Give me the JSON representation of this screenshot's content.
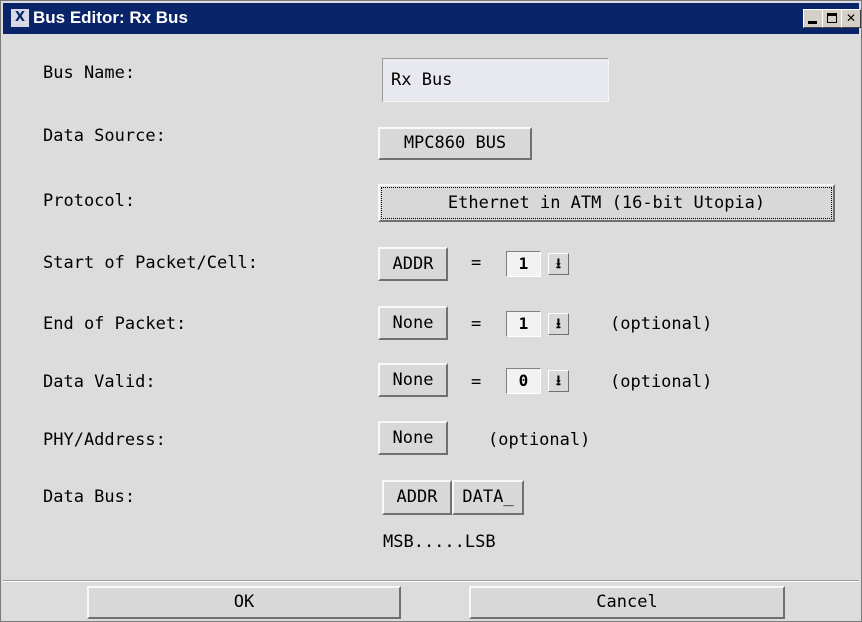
{
  "window": {
    "title": "Bus Editor: Rx Bus",
    "icon_glyph": "X"
  },
  "fields": {
    "bus_name": {
      "label": "Bus Name:",
      "value": "Rx Bus"
    },
    "data_source": {
      "label": "Data Source:",
      "button": "MPC860 BUS"
    },
    "protocol": {
      "label": "Protocol:",
      "button": "Ethernet in ATM (16-bit Utopia)"
    },
    "start_of_packet": {
      "label": "Start of Packet/Cell:",
      "button": "ADDR",
      "equals": "=",
      "value": "1"
    },
    "end_of_packet": {
      "label": "End of Packet:",
      "button": "None",
      "equals": "=",
      "value": "1",
      "note": "(optional)"
    },
    "data_valid": {
      "label": "Data Valid:",
      "button": "None",
      "equals": "=",
      "value": "0",
      "note": "(optional)"
    },
    "phy_address": {
      "label": "PHY/Address:",
      "button": "None",
      "note": "(optional)"
    },
    "data_bus": {
      "label": "Data Bus:",
      "buttons": [
        "ADDR",
        "DATA_"
      ],
      "caption": "MSB.....LSB"
    }
  },
  "actions": {
    "ok": "OK",
    "cancel": "Cancel"
  },
  "icons": {
    "app": "x-icon",
    "minimize": "minimize-icon",
    "maximize": "maximize-icon",
    "close": "close-icon",
    "dropdown": "down-arrow-icon"
  }
}
